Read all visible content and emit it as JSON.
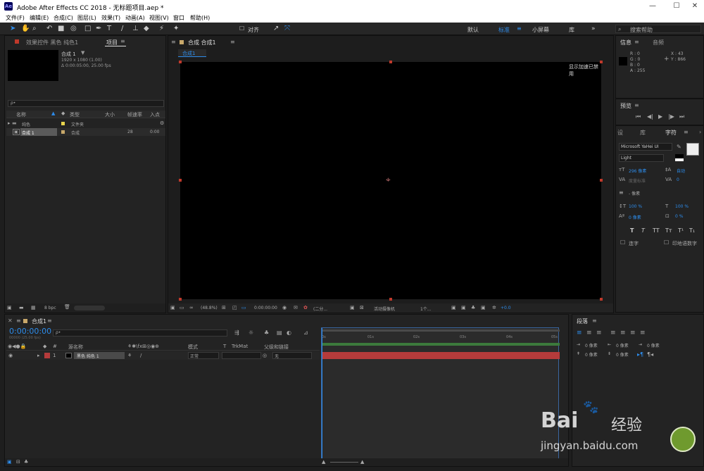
{
  "window": {
    "app_badge": "Ae",
    "title": "Adobe After Effects CC 2018 - 无标题项目.aep *",
    "minimize": "—",
    "maximize": "☐",
    "close": "✕"
  },
  "menu": [
    "文件(F)",
    "编辑(E)",
    "合成(C)",
    "图层(L)",
    "效果(T)",
    "动画(A)",
    "视图(V)",
    "窗口",
    "帮助(H)"
  ],
  "toolbar": {
    "align_label": "对齐",
    "workspaces": [
      "默认",
      "标准",
      "小屏幕",
      "库"
    ],
    "active_workspace": "标准",
    "search_placeholder": "搜索帮助",
    "more": "»"
  },
  "project_panel": {
    "tab_effects": "效果控件 黑色 纯色1",
    "tab_project": "项目",
    "comp_name": "合成 1",
    "comp_size": "1920 x 1080 (1.00)",
    "comp_duration": "Δ 0:00:05:00, 25.00 fps",
    "search_placeholder": "ρ•",
    "columns": [
      "名称",
      "类型",
      "大小",
      "帧速率",
      "入点"
    ],
    "items": [
      {
        "name": "纯色",
        "type": "文件夹",
        "size": "",
        "fps": "",
        "in": "",
        "kind": "folder",
        "color": "#e8d44d"
      },
      {
        "name": "合成 1",
        "type": "合成",
        "size": "",
        "fps": "28",
        "in": "0:00",
        "kind": "comp",
        "color": "#c8a86a"
      }
    ],
    "bpc": "8 bpc"
  },
  "comp_panel": {
    "header": "合成 合成1",
    "breadcrumb": "合成1",
    "notice": "显示加速已禁用",
    "zoom": "(48.8%)",
    "timecode": "0:00:00:00",
    "resolution": "(二分...",
    "camera": "活动摄像机",
    "views": "1个...",
    "exposure": "+0.0"
  },
  "info_panel": {
    "tab_info": "信息",
    "tab_audio": "音频",
    "r": "R : 0",
    "g": "G : 0",
    "b": "B : 0",
    "a": "A : 255",
    "x": "X : 43",
    "y": "Y : 866"
  },
  "preview_panel": {
    "title": "预览"
  },
  "character_panel": {
    "tabs": [
      "设",
      "库",
      "字符"
    ],
    "active_tab": "字符",
    "font": "Microsoft YaHei UI",
    "style": "Light",
    "size": "296 像素",
    "leading": "自动",
    "kerning": "度量标准",
    "tracking": "0",
    "stroke": "- 像素",
    "vscale": "100 %",
    "hscale": "100 %",
    "baseline": "0 像素",
    "tsume": "0 %",
    "styles": [
      "T",
      "T",
      "TT",
      "Tт",
      "T¹",
      "T₁"
    ],
    "ligatures": "连字",
    "hindi": "印地语数字"
  },
  "paragraph_panel": {
    "title": "段落",
    "indent_left": "0 像素",
    "indent_right": "0 像素",
    "indent_first": "0 像素",
    "space_before": "0 像素",
    "space_after": "0 像素"
  },
  "timeline": {
    "tab": "合成1",
    "timecode": "0:00:00:00",
    "frame_info": "00000 (25.00 fps)",
    "search_placeholder": "ρ•",
    "columns": {
      "num": "#",
      "source": "源名称",
      "mode": "模式",
      "t": "T",
      "trkmat": "TrkMat",
      "parent": "父级和链接"
    },
    "ruler": [
      "0s",
      "01s",
      "02s",
      "03s",
      "04s",
      "05s"
    ],
    "layers": [
      {
        "num": "1",
        "name": "黑色 纯色 1",
        "mode": "正常",
        "parent": "无",
        "color": "#b53b3b"
      }
    ]
  },
  "watermark": {
    "brand": "Bai",
    "brand2": "经验",
    "url": "jingyan.baidu.com"
  }
}
